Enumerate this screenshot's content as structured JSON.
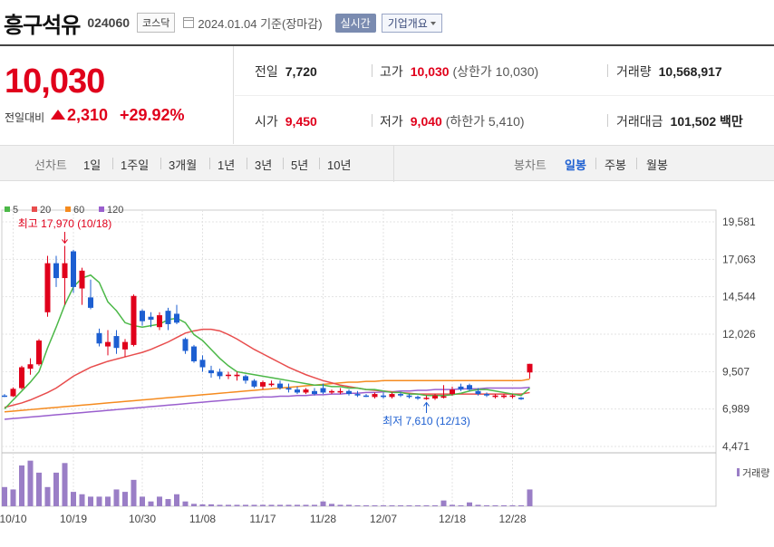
{
  "header": {
    "stock_name": "흥구석유",
    "stock_code": "024060",
    "market": "코스닥",
    "date_text": "2024.01.04 기준(장마감)",
    "realtime_label": "실시간",
    "company_button": "기업개요"
  },
  "price": {
    "current": "10,030",
    "change_label": "전일대비",
    "change": "2,310",
    "change_pct": "+29.92%"
  },
  "stats": {
    "prev_close_label": "전일",
    "prev_close": "7,720",
    "high_label": "고가",
    "high": "10,030",
    "upper_limit_label": "(상한가 10,030)",
    "volume_label": "거래량",
    "volume": "10,568,917",
    "open_label": "시가",
    "open": "9,450",
    "low_label": "저가",
    "low": "9,040",
    "lower_limit_label": "(하한가 5,410)",
    "trade_value_label": "거래대금",
    "trade_value": "101,502",
    "trade_value_unit": "백만"
  },
  "tabs": {
    "line_label": "선차트",
    "periods": [
      "1일",
      "1주일",
      "3개월",
      "1년",
      "3년",
      "5년",
      "10년"
    ],
    "candle_label": "봉차트",
    "candle_types": [
      "일봉",
      "주봉",
      "월봉"
    ],
    "active_candle": "일봉"
  },
  "chart_data": {
    "type": "candlestick",
    "legend": [
      "5",
      "20",
      "60",
      "120"
    ],
    "legend_colors": [
      "#4cb848",
      "#e84d4d",
      "#f58b1f",
      "#9a5fce"
    ],
    "up_color": "#e0001b",
    "down_color": "#1d5fd1",
    "y_ticks": [
      "19,581",
      "17,063",
      "14,544",
      "12,026",
      "9,507",
      "6,989",
      "4,471"
    ],
    "ylim": [
      4471,
      19581
    ],
    "x_ticks": [
      "10/10",
      "10/19",
      "10/30",
      "11/08",
      "11/17",
      "11/28",
      "12/07",
      "12/18",
      "12/28"
    ],
    "x_tick_index": [
      1,
      8,
      16,
      23,
      30,
      37,
      44,
      52,
      59
    ],
    "volume_label": "거래량",
    "max_annotation": "최고 17,970 (10/18)",
    "max_index": 7,
    "max_value": 17970,
    "min_annotation": "최저 7,610 (12/13)",
    "min_index": 49,
    "min_value": 7610,
    "candles": [
      [
        7900,
        8000,
        7800,
        7850
      ],
      [
        7850,
        8450,
        7800,
        8350
      ],
      [
        8400,
        9900,
        8300,
        9800
      ],
      [
        9700,
        10400,
        9300,
        10000
      ],
      [
        10000,
        11700,
        9900,
        11600
      ],
      [
        13500,
        17300,
        13200,
        16800
      ],
      [
        16800,
        17300,
        15200,
        15800
      ],
      [
        15800,
        17970,
        14000,
        16800
      ],
      [
        17600,
        17700,
        14800,
        15200
      ],
      [
        15100,
        16500,
        14000,
        16300
      ],
      [
        14500,
        15700,
        13700,
        13800
      ],
      [
        12100,
        12400,
        11200,
        11400
      ],
      [
        11200,
        12300,
        10600,
        11500
      ],
      [
        11900,
        12300,
        10700,
        11100
      ],
      [
        11000,
        11700,
        10500,
        11500
      ],
      [
        11300,
        14700,
        11200,
        14600
      ],
      [
        13600,
        13700,
        12600,
        12900
      ],
      [
        13200,
        13500,
        12500,
        13000
      ],
      [
        12500,
        13500,
        12300,
        13300
      ],
      [
        13600,
        13800,
        12300,
        12700
      ],
      [
        13400,
        14000,
        12700,
        12800
      ],
      [
        11700,
        11800,
        10700,
        10900
      ],
      [
        11200,
        11300,
        10100,
        10200
      ],
      [
        10300,
        10600,
        9500,
        9800
      ],
      [
        9600,
        9900,
        9100,
        9400
      ],
      [
        9500,
        9700,
        9000,
        9200
      ],
      [
        9300,
        9500,
        9000,
        9300
      ],
      [
        9200,
        9500,
        8900,
        9300
      ],
      [
        9200,
        9300,
        8700,
        8900
      ],
      [
        8900,
        9000,
        8400,
        8500
      ],
      [
        8500,
        8900,
        8300,
        8800
      ],
      [
        8600,
        8900,
        8500,
        8700
      ],
      [
        8700,
        8900,
        8300,
        8400
      ],
      [
        8400,
        8700,
        8100,
        8300
      ],
      [
        8300,
        8500,
        8000,
        8100
      ],
      [
        8100,
        8400,
        8000,
        8300
      ],
      [
        8200,
        8400,
        7900,
        8000
      ],
      [
        8400,
        8700,
        8000,
        8100
      ],
      [
        8100,
        8300,
        8000,
        8200
      ],
      [
        8100,
        8400,
        8000,
        8200
      ],
      [
        8200,
        8300,
        7900,
        8000
      ],
      [
        8000,
        8200,
        7800,
        7900
      ],
      [
        7900,
        8000,
        7800,
        7850
      ],
      [
        7800,
        8100,
        7700,
        8000
      ],
      [
        7900,
        8100,
        7700,
        7800
      ],
      [
        7800,
        8100,
        7700,
        8000
      ],
      [
        8000,
        8100,
        7800,
        7900
      ],
      [
        7900,
        8000,
        7700,
        7800
      ],
      [
        7800,
        7900,
        7610,
        7700
      ],
      [
        7700,
        7900,
        7610,
        7750
      ],
      [
        7700,
        8000,
        7600,
        7900
      ],
      [
        7750,
        8600,
        7700,
        7850
      ],
      [
        8000,
        8500,
        7900,
        8300
      ],
      [
        8500,
        8700,
        8200,
        8300
      ],
      [
        8600,
        8700,
        8200,
        8300
      ],
      [
        8200,
        8400,
        7900,
        8000
      ],
      [
        8000,
        8100,
        7800,
        7900
      ],
      [
        7800,
        8000,
        7700,
        7900
      ],
      [
        7800,
        8000,
        7700,
        7900
      ],
      [
        7850,
        8000,
        7700,
        7900
      ],
      [
        7750,
        7800,
        7600,
        7650
      ],
      [
        9450,
        10030,
        9040,
        10030
      ]
    ],
    "ma5": [
      7000,
      7600,
      8200,
      8800,
      9500,
      11100,
      12500,
      14000,
      15200,
      15800,
      16000,
      15500,
      14200,
      13600,
      12800,
      12600,
      12500,
      12600,
      12700,
      13000,
      13100,
      12800,
      12000,
      11600,
      11000,
      10400,
      9900,
      9500,
      9400,
      9300,
      9200,
      9100,
      9000,
      8900,
      8800,
      8700,
      8600,
      8600,
      8500,
      8500,
      8400,
      8400,
      8300,
      8300,
      8200,
      8100,
      8100,
      8000,
      8000,
      7900,
      7900,
      7900,
      7950,
      8050,
      8200,
      8300,
      8300,
      8200,
      8100,
      8000,
      7900,
      8400
    ],
    "ma20": [
      7100,
      7250,
      7400,
      7600,
      7850,
      8100,
      8400,
      8800,
      9200,
      9500,
      9800,
      10000,
      10200,
      10350,
      10500,
      10650,
      10800,
      11000,
      11250,
      11500,
      11800,
      12100,
      12250,
      12350,
      12350,
      12250,
      12000,
      11700,
      11350,
      11000,
      10700,
      10400,
      10100,
      9800,
      9550,
      9300,
      9100,
      8900,
      8750,
      8600,
      8500,
      8400,
      8300,
      8250,
      8200,
      8150,
      8100,
      8050,
      8000,
      8000,
      8000,
      8000,
      8000,
      8000,
      8000,
      8000,
      8000,
      8000,
      8000,
      8000,
      8000,
      8100
    ],
    "ma60": [
      6800,
      6850,
      6900,
      6950,
      7000,
      7050,
      7100,
      7150,
      7200,
      7250,
      7300,
      7350,
      7400,
      7450,
      7500,
      7550,
      7600,
      7650,
      7700,
      7750,
      7800,
      7850,
      7900,
      7950,
      8000,
      8050,
      8100,
      8150,
      8200,
      8250,
      8300,
      8350,
      8400,
      8450,
      8500,
      8550,
      8600,
      8650,
      8700,
      8750,
      8800,
      8800,
      8850,
      8850,
      8900,
      8900,
      8900,
      8900,
      8900,
      8900,
      8900,
      8900,
      8900,
      8900,
      8900,
      8900,
      8900,
      8900,
      8900,
      8900,
      8900,
      9000
    ],
    "ma120": [
      6300,
      6350,
      6400,
      6450,
      6500,
      6550,
      6600,
      6650,
      6700,
      6750,
      6800,
      6850,
      6900,
      6950,
      7000,
      7050,
      7100,
      7150,
      7200,
      7250,
      7300,
      7350,
      7400,
      7450,
      7500,
      7550,
      7600,
      7650,
      7700,
      7750,
      7800,
      7800,
      7850,
      7850,
      7900,
      7900,
      7950,
      7950,
      8000,
      8000,
      8050,
      8050,
      8100,
      8100,
      8150,
      8150,
      8200,
      8200,
      8250,
      8250,
      8300,
      8300,
      8300,
      8350,
      8350,
      8350,
      8400,
      8400,
      8400,
      8400,
      8400,
      8450
    ],
    "volume": [
      0.4,
      0.35,
      0.85,
      0.95,
      0.7,
      0.4,
      0.7,
      0.9,
      0.3,
      0.25,
      0.2,
      0.2,
      0.2,
      0.35,
      0.3,
      0.55,
      0.2,
      0.1,
      0.2,
      0.15,
      0.25,
      0.1,
      0.05,
      0.04,
      0.04,
      0.03,
      0.03,
      0.03,
      0.03,
      0.03,
      0.03,
      0.03,
      0.03,
      0.03,
      0.03,
      0.03,
      0.03,
      0.1,
      0.05,
      0.03,
      0.03,
      0.02,
      0.02,
      0.02,
      0.02,
      0.02,
      0.02,
      0.02,
      0.02,
      0.02,
      0.02,
      0.12,
      0.03,
      0.02,
      0.08,
      0.03,
      0.02,
      0.02,
      0.02,
      0.02,
      0.02,
      0.35
    ]
  }
}
